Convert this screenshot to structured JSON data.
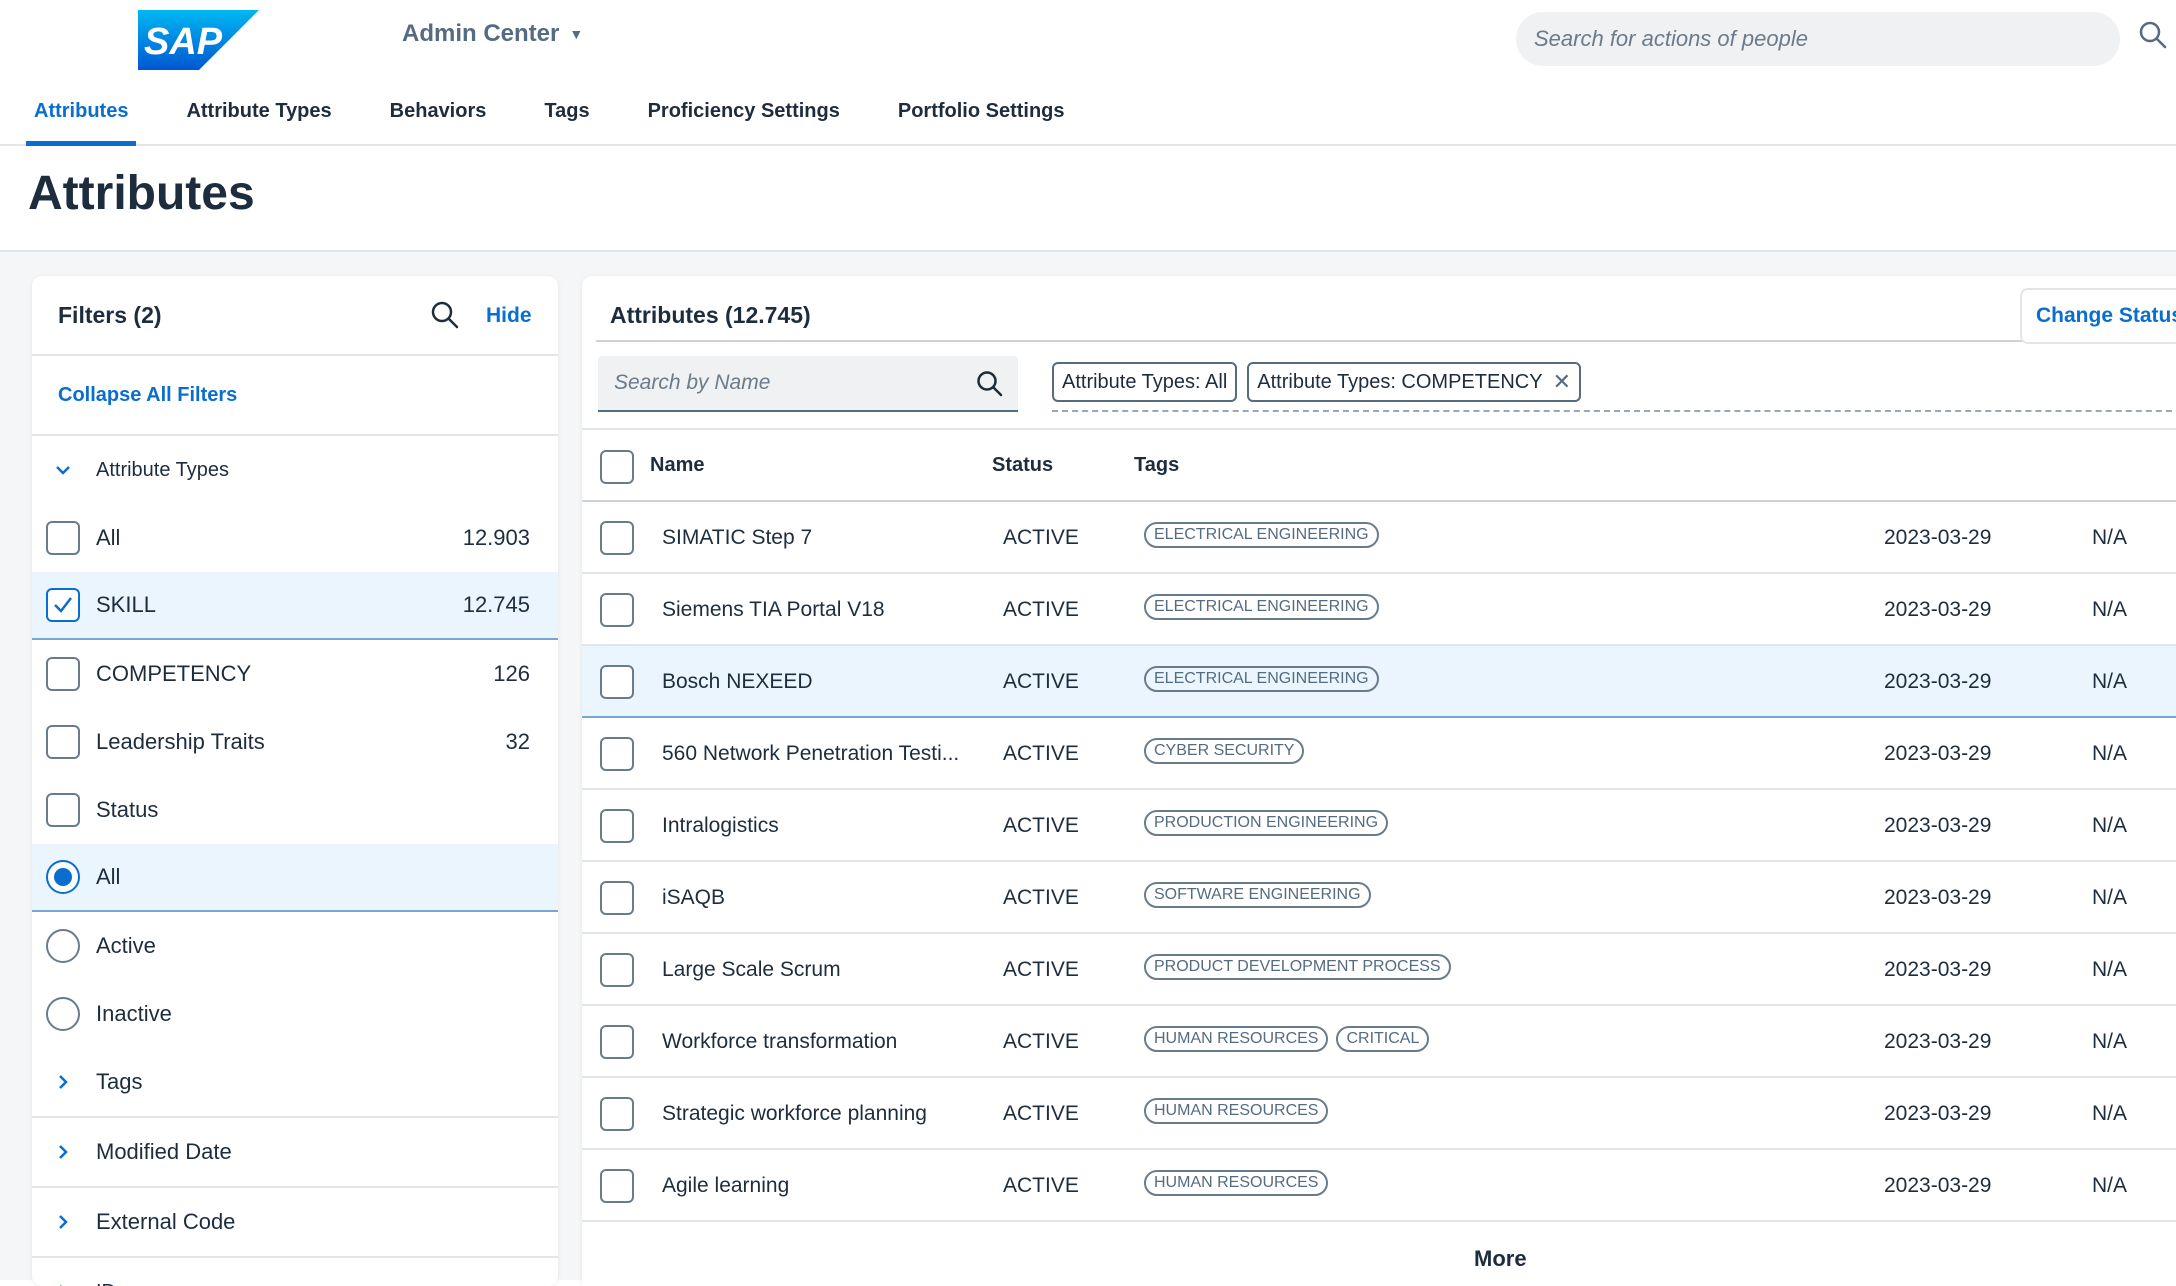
{
  "header": {
    "logo_text": "SAP",
    "app_title": "Admin Center",
    "search_placeholder": "Search for actions of people"
  },
  "tabs": [
    {
      "label": "Attributes",
      "active": true
    },
    {
      "label": "Attribute Types"
    },
    {
      "label": "Behaviors"
    },
    {
      "label": "Tags"
    },
    {
      "label": "Proficiency Settings"
    },
    {
      "label": "Portfolio Settings"
    }
  ],
  "page_title": "Attributes",
  "filters": {
    "title": "Filters (2)",
    "hide_label": "Hide",
    "collapse_label": "Collapse All Filters",
    "attribute_types": {
      "label": "Attribute Types",
      "options": [
        {
          "label": "All",
          "count": "12.903",
          "checked": false
        },
        {
          "label": "SKILL",
          "count": "12.745",
          "checked": true
        },
        {
          "label": "COMPETENCY",
          "count": "126",
          "checked": false
        },
        {
          "label": "Leadership Traits",
          "count": "32",
          "checked": false
        }
      ]
    },
    "status": {
      "label": "Status",
      "options": [
        {
          "label": "All",
          "selected": true
        },
        {
          "label": "Active",
          "selected": false
        },
        {
          "label": "Inactive",
          "selected": false
        }
      ]
    },
    "collapsed_groups": [
      "Tags",
      "Modified Date",
      "External Code",
      "ID"
    ]
  },
  "table": {
    "title": "Attributes  (12.745)",
    "change_status_label": "Change Status",
    "search_placeholder": "Search by Name",
    "chips": [
      {
        "label": "Attribute Types: All",
        "removable": false
      },
      {
        "label": "Attribute Types:  COMPETENCY",
        "removable": true
      }
    ],
    "columns": {
      "name": "Name",
      "status": "Status",
      "tags": "Tags"
    },
    "rows": [
      {
        "name": "SIMATIC Step 7",
        "status": "ACTIVE",
        "tags": [
          "ELECTRICAL ENGINEERING"
        ],
        "date": "2023-03-29",
        "extra": "N/A"
      },
      {
        "name": "Siemens TIA Portal V18",
        "status": "ACTIVE",
        "tags": [
          "ELECTRICAL ENGINEERING"
        ],
        "date": "2023-03-29",
        "extra": "N/A"
      },
      {
        "name": "Bosch NEXEED",
        "status": "ACTIVE",
        "tags": [
          "ELECTRICAL ENGINEERING"
        ],
        "date": "2023-03-29",
        "extra": "N/A"
      },
      {
        "name": "560 Network Penetration Testi...",
        "status": "ACTIVE",
        "tags": [
          "CYBER SECURITY"
        ],
        "date": "2023-03-29",
        "extra": "N/A"
      },
      {
        "name": "Intralogistics",
        "status": "ACTIVE",
        "tags": [
          "PRODUCTION ENGINEERING"
        ],
        "date": "2023-03-29",
        "extra": "N/A"
      },
      {
        "name": "iSAQB",
        "status": "ACTIVE",
        "tags": [
          "SOFTWARE ENGINEERING"
        ],
        "date": "2023-03-29",
        "extra": "N/A"
      },
      {
        "name": "Large Scale Scrum",
        "status": "ACTIVE",
        "tags": [
          "PRODUCT DEVELOPMENT PROCESS"
        ],
        "date": "2023-03-29",
        "extra": "N/A"
      },
      {
        "name": "Workforce transformation",
        "status": "ACTIVE",
        "tags": [
          "HUMAN RESOURCES",
          "CRITICAL"
        ],
        "date": "2023-03-29",
        "extra": "N/A"
      },
      {
        "name": "Strategic workforce planning",
        "status": "ACTIVE",
        "tags": [
          "HUMAN RESOURCES"
        ],
        "date": "2023-03-29",
        "extra": "N/A"
      },
      {
        "name": "Agile learning",
        "status": "ACTIVE",
        "tags": [
          "HUMAN RESOURCES"
        ],
        "date": "2023-03-29",
        "extra": "N/A"
      }
    ],
    "more_label": "More"
  },
  "colors": {
    "accent": "#0a6ed1",
    "text": "#1d2d3e",
    "muted": "#556b82",
    "selection": "#ebf5fe"
  }
}
